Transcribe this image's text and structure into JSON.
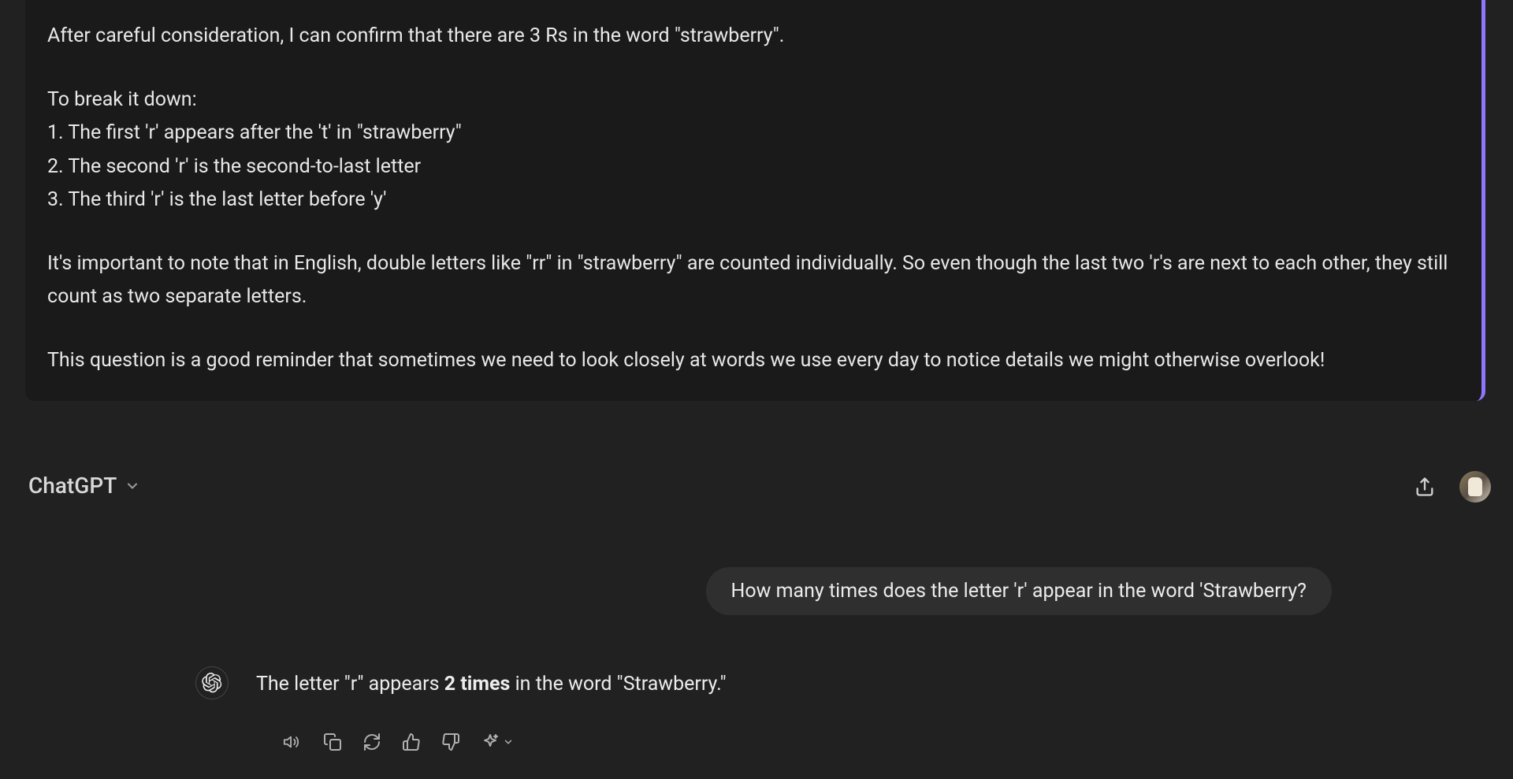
{
  "topResponse": {
    "line1": "After careful consideration, I can confirm that there are 3 Rs in the word \"strawberry\".",
    "breakdownIntro": "To break it down:",
    "item1": "1. The first 'r' appears after the 't' in \"strawberry\"",
    "item2": "2. The second 'r' is the second-to-last letter",
    "item3": "3. The third 'r' is the last letter before 'y'",
    "note": "It's important to note that in English, double letters like \"rr\" in \"strawberry\" are counted individually. So even though the last two 'r's are next to each other, they still count as two separate letters.",
    "closing": "This question is a good reminder that sometimes we need to look closely at words we use every day to notice details we might otherwise overlook!"
  },
  "chatgpt": {
    "title": "ChatGPT",
    "userMessage": "How many times does the letter 'r' appear in the word 'Strawberry?",
    "assistant": {
      "prefix": "The letter \"r\" appears ",
      "bold": "2 times",
      "suffix": " in the word \"Strawberry.\""
    }
  }
}
